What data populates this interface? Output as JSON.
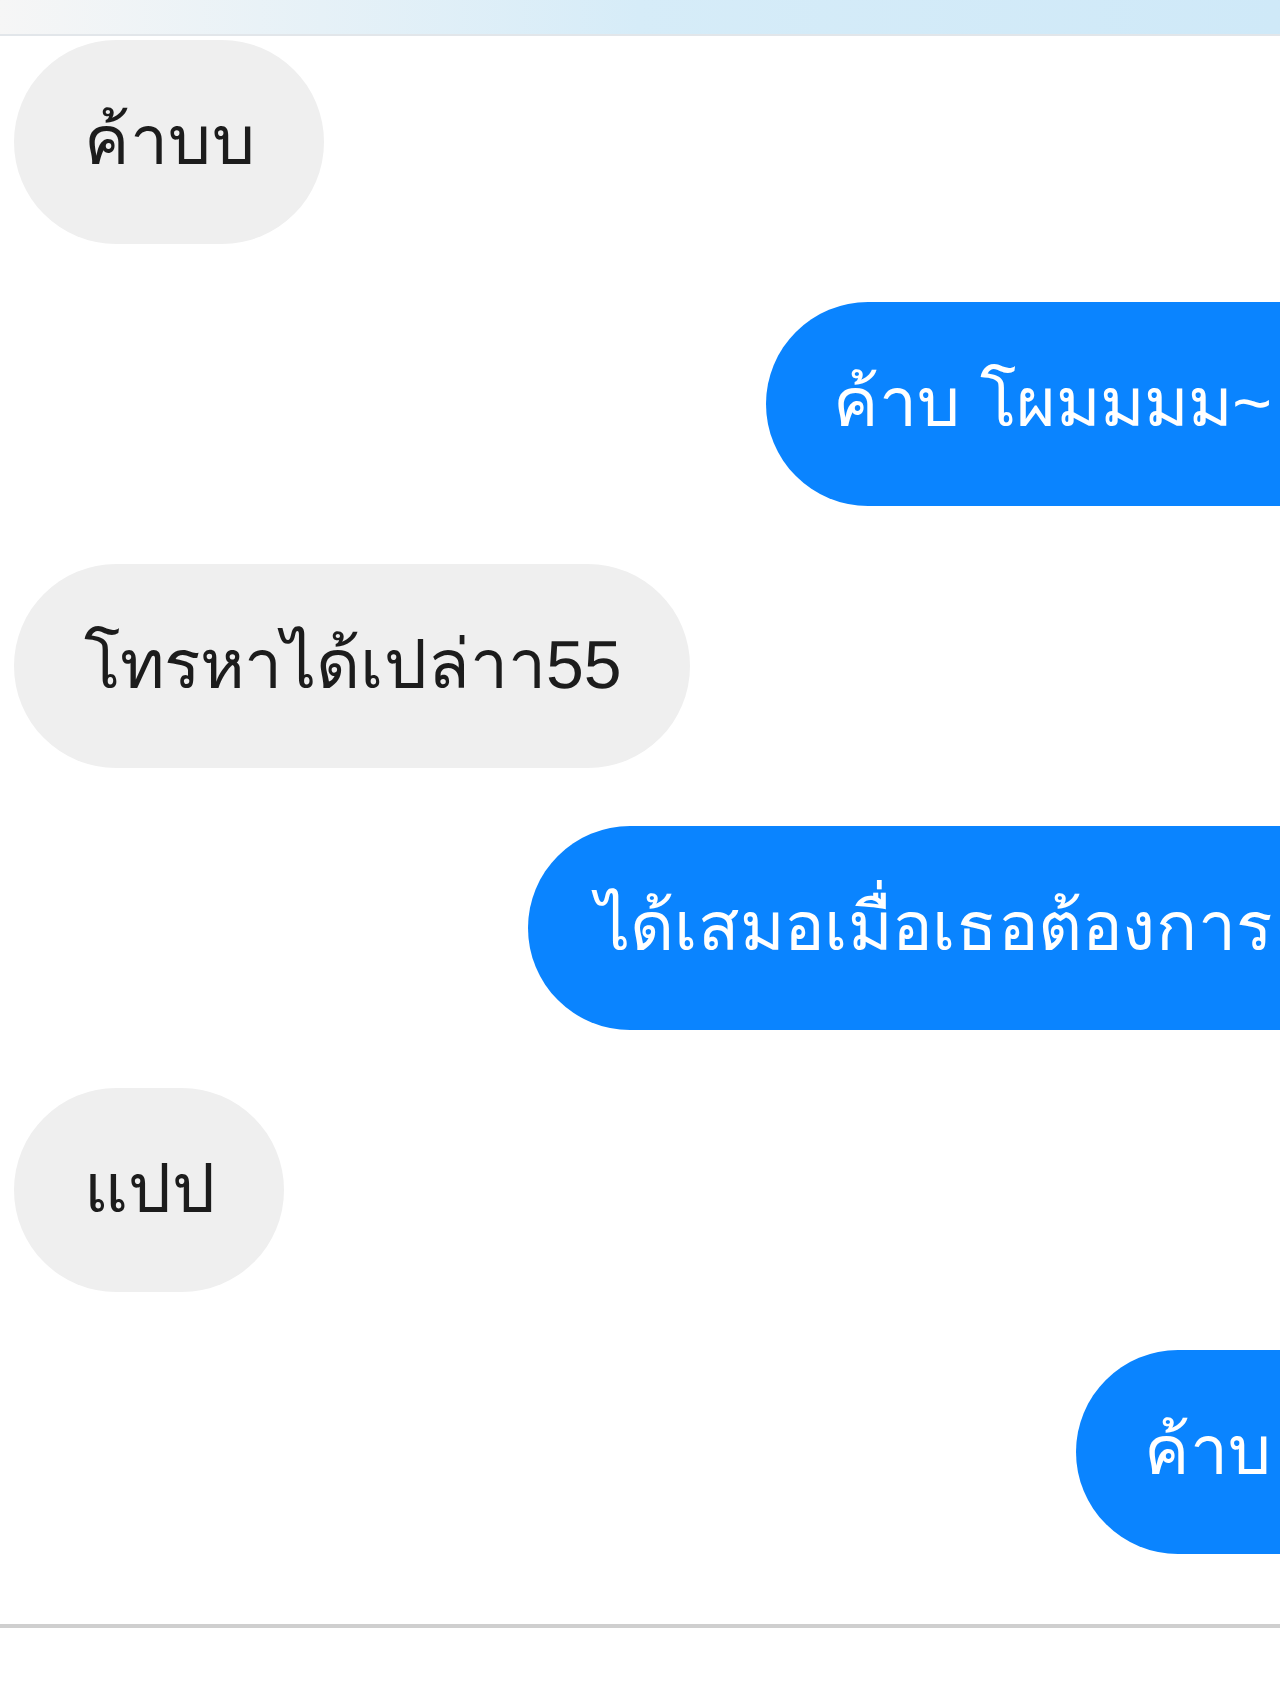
{
  "messages": [
    {
      "kind": "received",
      "text": "ค้าบบ"
    },
    {
      "kind": "sent",
      "text": "ค้าบ โผมมมม~"
    },
    {
      "kind": "received",
      "text": "โทรหาได้เปล่าา55"
    },
    {
      "kind": "sent",
      "text": "ได้เสมอเมื่อเธอต้องการ"
    },
    {
      "kind": "received",
      "text": "แปป"
    },
    {
      "kind": "sent",
      "text": "ค้าบ"
    }
  ]
}
